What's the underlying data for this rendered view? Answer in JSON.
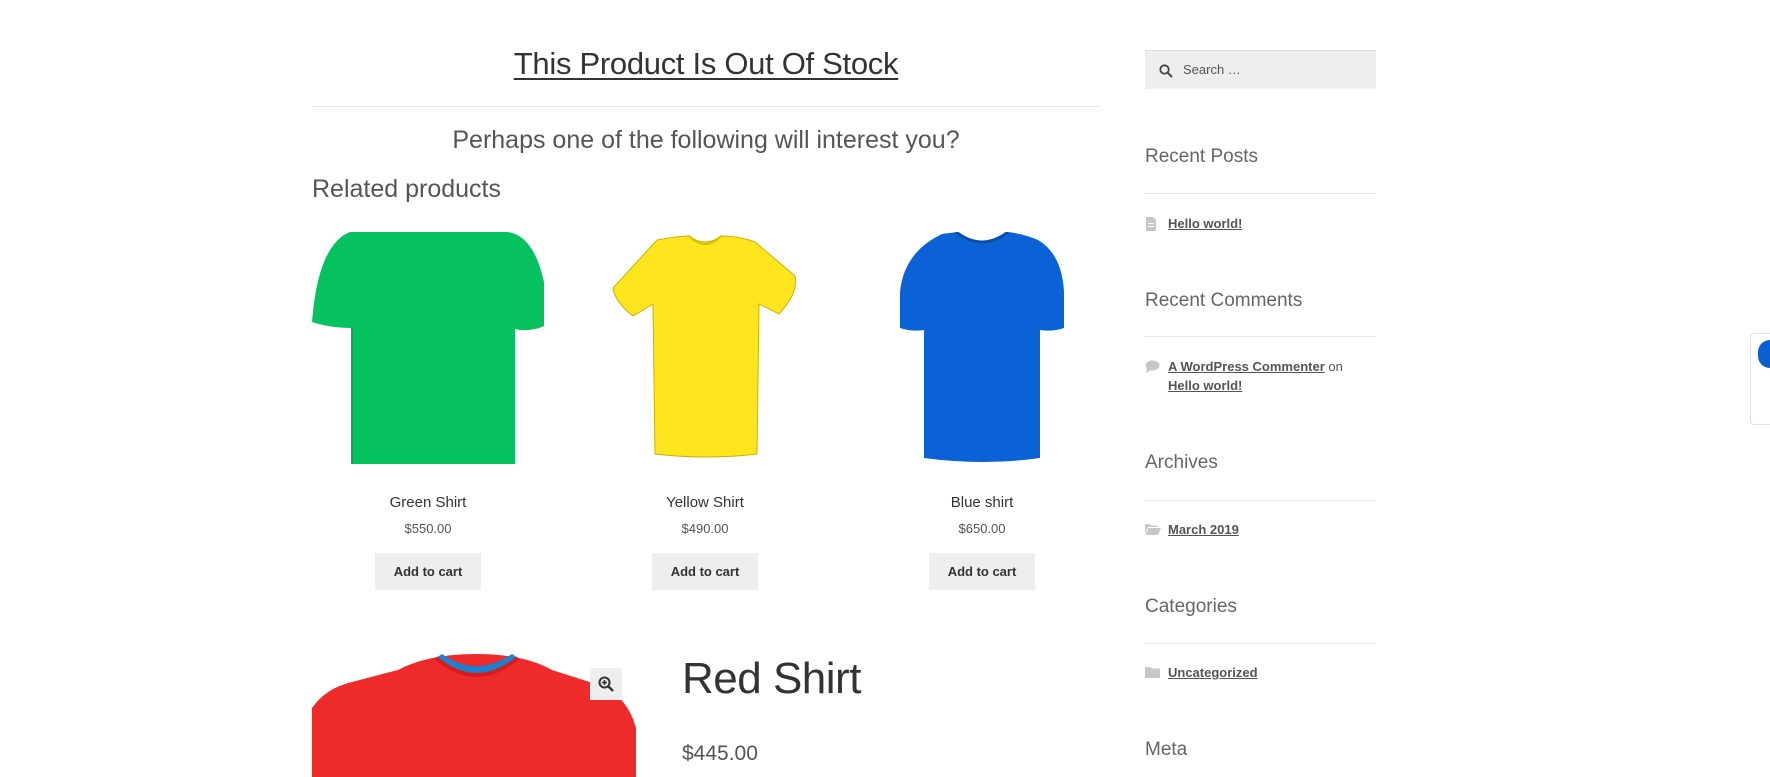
{
  "page": {
    "title": "This Product Is Out Of Stock",
    "subtitle": "Perhaps one of the following will interest you?",
    "related_heading": "Related products"
  },
  "related_products": [
    {
      "name": "Green Shirt",
      "price": "$550.00",
      "button": "Add to cart",
      "color": "#05c160"
    },
    {
      "name": "Yellow Shirt",
      "price": "$490.00",
      "button": "Add to cart",
      "color": "#ffe51e"
    },
    {
      "name": "Blue shirt",
      "price": "$650.00",
      "button": "Add to cart",
      "color": "#0a62d6"
    }
  ],
  "featured_product": {
    "name": "Red Shirt",
    "price": "$445.00",
    "color": "#ee2a2a",
    "zoom_icon": "magnifier-plus-icon"
  },
  "sidebar": {
    "search_placeholder": "Search …",
    "recent_posts_title": "Recent Posts",
    "recent_posts": [
      {
        "label": "Hello world!",
        "icon": "document-icon"
      }
    ],
    "recent_comments_title": "Recent Comments",
    "recent_comments": [
      {
        "author": "A WordPress Commenter",
        "on": "on",
        "post": "Hello world!",
        "icon": "comment-icon"
      }
    ],
    "archives_title": "Archives",
    "archives": [
      {
        "label": "March 2019",
        "icon": "folder-open-icon"
      }
    ],
    "categories_title": "Categories",
    "categories": [
      {
        "label": "Uncategorized",
        "icon": "folder-icon"
      }
    ],
    "meta_title": "Meta"
  }
}
